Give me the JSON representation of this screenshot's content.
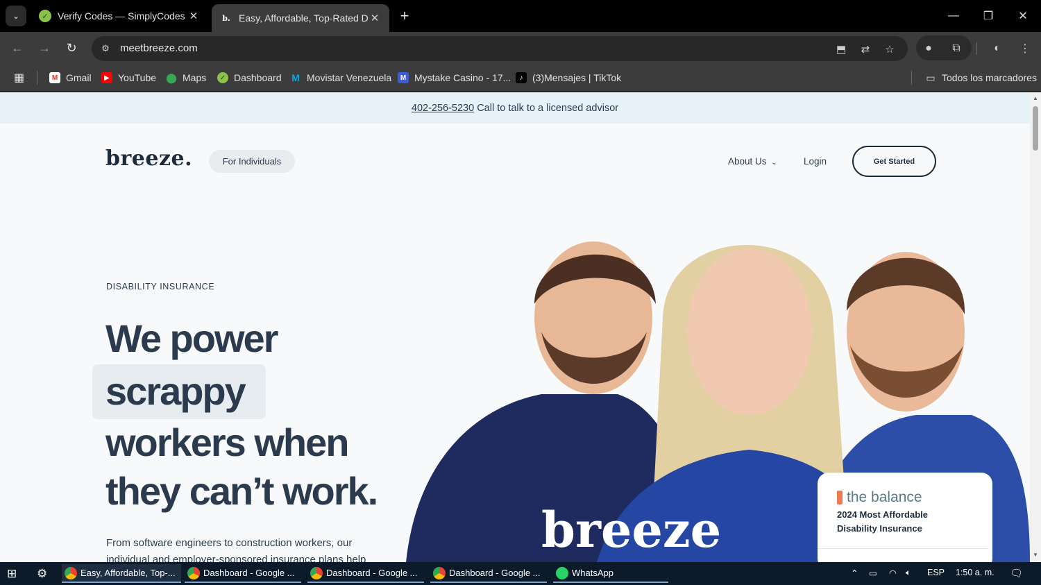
{
  "browser": {
    "tabs": [
      {
        "title": "Verify Codes — SimplyCodes",
        "active": false
      },
      {
        "title": "Easy, Affordable, Top-Rated Dis",
        "active": true
      }
    ],
    "url": "meetbreeze.com"
  },
  "bookmarks": {
    "items": [
      "Gmail",
      "YouTube",
      "Maps",
      "Dashboard",
      "Movistar Venezuela",
      "Mystake Casino - 17...",
      "(3)Mensajes | TikTok"
    ],
    "all_label": "Todos los marcadores"
  },
  "site": {
    "promo_phone": "402-256-5230",
    "promo_text": "Call to talk to a licensed advisor",
    "logo": "breeze.",
    "segment": "For Individuals",
    "nav": {
      "about": "About Us",
      "login": "Login",
      "cta": "Get Started"
    },
    "eyebrow": "DISABILITY INSURANCE",
    "headline": [
      "We power",
      "scrappy",
      "workers when",
      "they can’t work."
    ],
    "subtext": "From software engineers to construction workers, our individual and employer-sponsored insurance plans help",
    "award": {
      "brand": "the balance",
      "line1": "2024 Most Affordable",
      "line2": "Disability Insurance"
    },
    "shirt_text": "breeze"
  },
  "taskbar": {
    "items": [
      "Easy, Affordable, Top-...",
      "Dashboard - Google ...",
      "Dashboard - Google ...",
      "Dashboard - Google ...",
      "WhatsApp"
    ],
    "lang": "ESP",
    "time": "1:50 a. m."
  },
  "colors": {
    "accent": "#2b3b4d",
    "page_bg": "#f7f9fb",
    "promo_bg": "#e6f1f8",
    "shirt": "#1f2b5e"
  }
}
